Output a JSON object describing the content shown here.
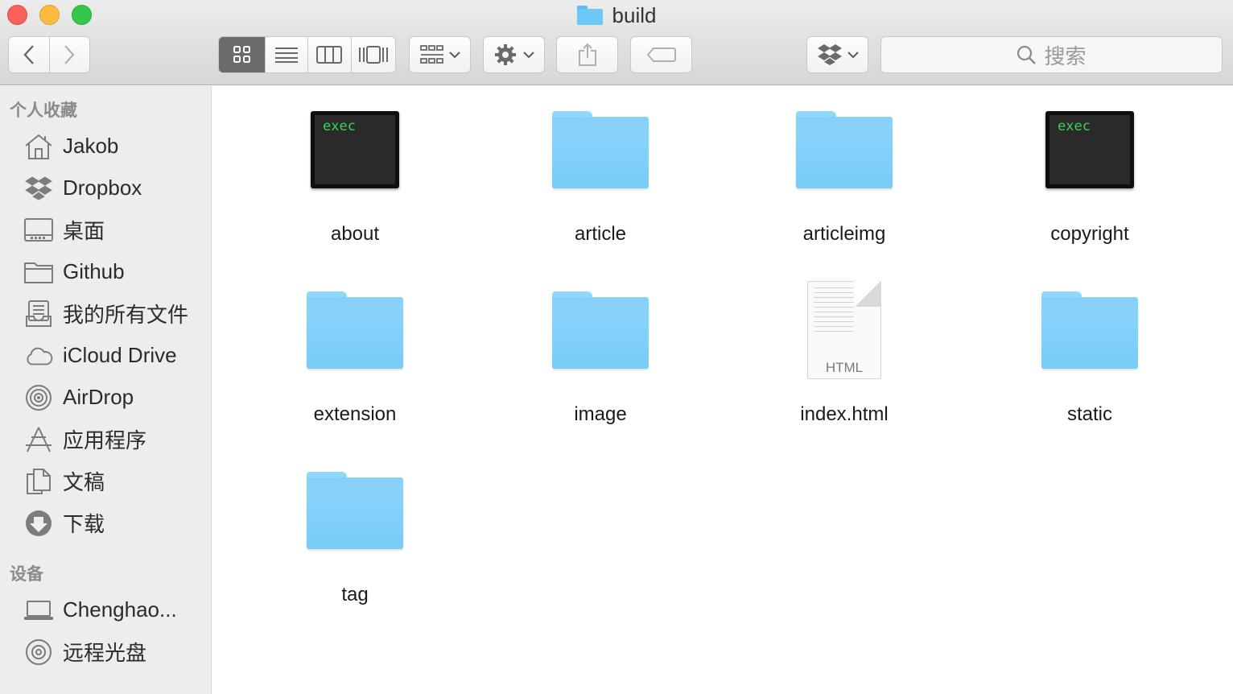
{
  "window": {
    "title": "build"
  },
  "toolbar": {
    "back_icon": "chevron-left-icon",
    "forward_icon": "chevron-right-icon",
    "views": [
      "icon-view",
      "list-view",
      "column-view",
      "cover-flow-view"
    ],
    "active_view": "icon-view",
    "search_placeholder": "搜索"
  },
  "sidebar": {
    "favorites_title": "个人收藏",
    "favorites": [
      {
        "label": "Jakob",
        "icon": "home-icon"
      },
      {
        "label": "Dropbox",
        "icon": "dropbox-icon"
      },
      {
        "label": "桌面",
        "icon": "desktop-icon"
      },
      {
        "label": "Github",
        "icon": "folder-icon"
      },
      {
        "label": "我的所有文件",
        "icon": "all-files-icon"
      },
      {
        "label": "iCloud Drive",
        "icon": "cloud-icon"
      },
      {
        "label": "AirDrop",
        "icon": "airdrop-icon"
      },
      {
        "label": "应用程序",
        "icon": "applications-icon"
      },
      {
        "label": "文稿",
        "icon": "documents-icon"
      },
      {
        "label": "下载",
        "icon": "download-icon"
      }
    ],
    "devices_title": "设备",
    "devices": [
      {
        "label": "Chenghao...",
        "icon": "laptop-icon"
      },
      {
        "label": "远程光盘",
        "icon": "disc-icon"
      }
    ]
  },
  "files": [
    {
      "name": "about",
      "kind": "exec",
      "badge": "exec"
    },
    {
      "name": "article",
      "kind": "folder"
    },
    {
      "name": "articleimg",
      "kind": "folder"
    },
    {
      "name": "copyright",
      "kind": "exec",
      "badge": "exec"
    },
    {
      "name": "extension",
      "kind": "folder"
    },
    {
      "name": "image",
      "kind": "folder"
    },
    {
      "name": "index.html",
      "kind": "document",
      "badge": "HTML"
    },
    {
      "name": "static",
      "kind": "folder"
    },
    {
      "name": "tag",
      "kind": "folder"
    }
  ],
  "colors": {
    "folder": "#86d0fa",
    "exec_text": "#33d65b",
    "sidebar_bg": "#efecef",
    "close": "#fc605c",
    "minimize": "#fdbc40",
    "maximize": "#34c84a"
  }
}
